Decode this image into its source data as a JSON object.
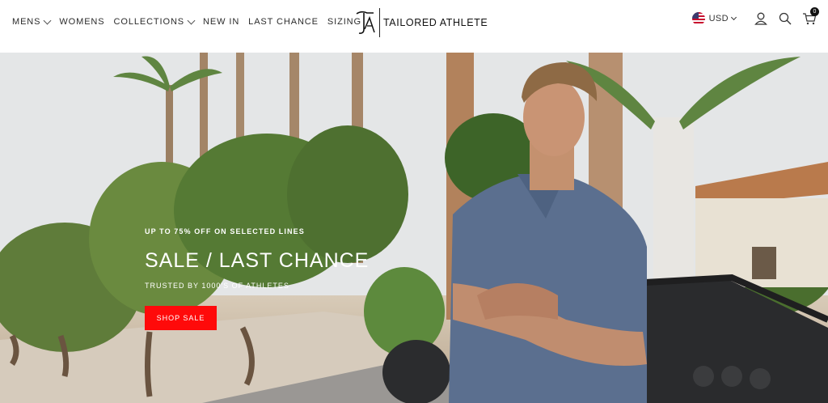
{
  "nav": {
    "items": [
      {
        "label": "MENS",
        "has_dropdown": true
      },
      {
        "label": "WOMENS",
        "has_dropdown": false
      },
      {
        "label": "COLLECTIONS",
        "has_dropdown": true
      },
      {
        "label": "NEW IN",
        "has_dropdown": false
      },
      {
        "label": "LAST CHANCE",
        "has_dropdown": false
      },
      {
        "label": "SIZING",
        "has_dropdown": false
      }
    ]
  },
  "brand": {
    "name": "TAILORED ATHLETE"
  },
  "header_tools": {
    "currency": "USD",
    "cart_count": "0",
    "icons": [
      "us-flag-icon",
      "account-icon",
      "search-icon",
      "cart-icon"
    ]
  },
  "hero": {
    "eyebrow": "UP TO 75% OFF ON SELECTED LINES",
    "title": "SALE / LAST CHANCE",
    "tagline": "TRUSTED BY 1000'S OF ATHLETES",
    "cta_label": "SHOP SALE"
  },
  "colors": {
    "cta": "#ff0a0a",
    "text": "#2b2b2b",
    "shirt": "#5b6f8f"
  }
}
